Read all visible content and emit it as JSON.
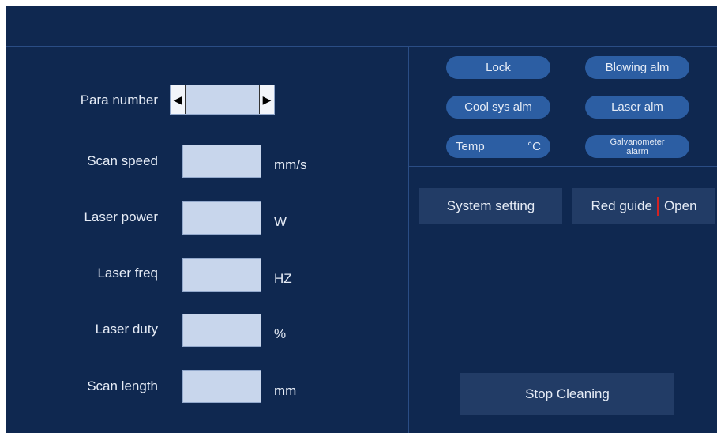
{
  "params": {
    "para_number_label": "Para number",
    "rows": [
      {
        "label": "Scan speed",
        "unit": "mm/s"
      },
      {
        "label": "Laser power",
        "unit": "W"
      },
      {
        "label": "Laser freq",
        "unit": "HZ"
      },
      {
        "label": "Laser duty",
        "unit": "%"
      },
      {
        "label": "Scan length",
        "unit": "mm"
      }
    ],
    "stepper_left": "◀",
    "stepper_right": "▶"
  },
  "status": {
    "lock": "Lock",
    "blowing_alm": "Blowing alm",
    "cool_sys_alm": "Cool sys alm",
    "laser_alm": "Laser alm",
    "temp": "Temp",
    "temp_unit": "°C",
    "galvanometer_line1": "Galvanometer",
    "galvanometer_line2": "alarm"
  },
  "controls": {
    "system_setting": "System setting",
    "red_guide": "Red guide",
    "red_guide_state": "Open",
    "stop_cleaning": "Stop Cleaning"
  }
}
